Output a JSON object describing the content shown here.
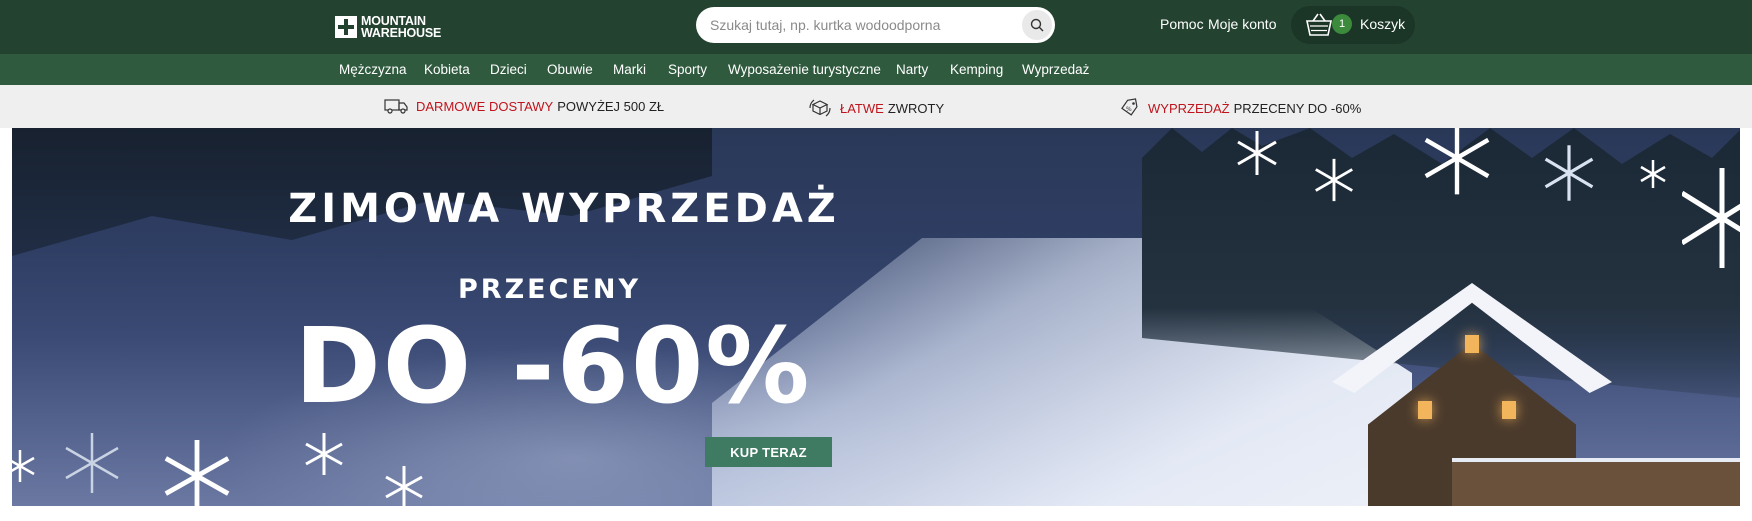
{
  "header": {
    "logo_line1": "MOUNTAIN",
    "logo_line2": "WAREHOUSE",
    "search_placeholder": "Szukaj tutaj, np. kurtka wodoodporna",
    "help_label": "Pomoc",
    "account_label": "Moje konto",
    "cart_count": "1",
    "cart_label": "Koszyk"
  },
  "nav": {
    "items": [
      {
        "label": "Mężczyzna"
      },
      {
        "label": "Kobieta"
      },
      {
        "label": "Dzieci"
      },
      {
        "label": "Obuwie"
      },
      {
        "label": "Marki"
      },
      {
        "label": "Sporty"
      },
      {
        "label": "Wyposażenie turystyczne"
      },
      {
        "label": "Narty"
      },
      {
        "label": "Kemping"
      },
      {
        "label": "Wyprzedaż"
      }
    ]
  },
  "benefits": [
    {
      "highlight": "DARMOWE DOSTAWY",
      "text": "POWYŻEJ 500 ZŁ",
      "icon": "truck-icon"
    },
    {
      "highlight": "ŁATWE",
      "text": "ZWROTY",
      "icon": "box-return-icon"
    },
    {
      "highlight": "WYPRZEDAŻ",
      "text": "PRZECENY DO -60%",
      "icon": "sale-tag-icon"
    }
  ],
  "hero": {
    "title": "ZIMOWA WYPRZEDAŻ",
    "subtitle": "PRZECENY",
    "big_text": "DO -60%",
    "cta_label": "KUP TERAZ"
  },
  "colors": {
    "header_bg": "#23422f",
    "nav_bg": "#2f5a3e",
    "highlight_red": "#c0141c",
    "cta_green": "#3f7a63",
    "cart_badge": "#3c8a3c"
  }
}
